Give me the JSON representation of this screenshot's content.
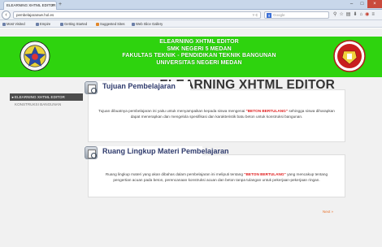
{
  "browser": {
    "tab_title": "ELEARNING XHTML EDITOR",
    "tab_close": "×",
    "new_tab": "+",
    "window_buttons": [
      "–",
      "□",
      "×"
    ],
    "url": "pembelajaranwe.hol.es",
    "url_right": "▿ ᴄ",
    "search_placeholder": "Google",
    "search_engine": "g",
    "toolbar_icons": [
      "⚲",
      "☆",
      "▤",
      "⬇",
      "⌂",
      "◉",
      "≡"
    ],
    "bookmarks": [
      "Most Visited",
      "Empire",
      "Getting Started",
      "Suggested Sites",
      "Web Slice Gallery"
    ]
  },
  "banner": {
    "lines": [
      "ELEARNING XHTML EDITOR",
      "SMK NEGERI 5 MEDAN",
      "FAKULTAS TEKNIK - PENDIDIKAN TEKNIK BANGUNAN",
      "UNIVERSITAS NEGERI MEDAN"
    ],
    "color": "#2ed30e"
  },
  "sidebar": {
    "items": [
      {
        "label": "ELEARNING XHTML EDITOR",
        "active": true
      },
      {
        "label": "KONSTRUKSI BANGUNAN",
        "active": false
      }
    ],
    "arrow": "►"
  },
  "main": {
    "title": "ELEARNING XHTML EDITOR",
    "sections": [
      {
        "title": "Tujuan Pembelajaran",
        "text_before": "Tujuan dibuatnya pembelajaran ini yaitu untuk menyampaikan kepada siswa mengenai ",
        "highlight": "\"BETON BERTULANG\"",
        "text_after": " sehingga siswa diharapkan dapat menerapkan dan mengelola spesifikasi dan karakteristik batu beton untuk konstruksi bangunan."
      },
      {
        "title": "Ruang Lingkup Materi Pembelajaran",
        "text_before": "Ruang lingkup materi yang akan dibahas dalam pembelajaran ini meliputi tentang ",
        "highlight": "\"BETON BERTULANG\"",
        "text_after": " yang mencakup tentang pengertian acuan pada beton, perencanaan konstruksi acuan dan beton tanpa tulangan untuk pekerjaan-pekerjaan ringan."
      }
    ],
    "next_link": "Next »",
    "accent": "#e8712b",
    "highlight_color": "#e01e1e"
  }
}
